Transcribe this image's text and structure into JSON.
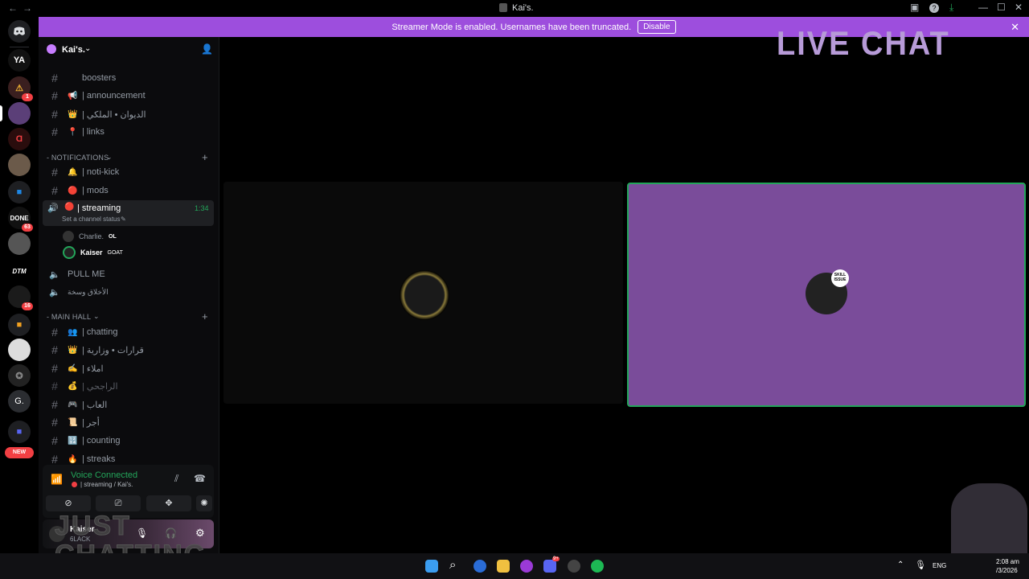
{
  "window": {
    "title": "Kai's.",
    "back_label": "←",
    "forward_label": "→",
    "minimize": "—",
    "maximize": "☐",
    "close": "✕"
  },
  "banner": {
    "text": "Streamer Mode is enabled. Usernames have been truncated.",
    "button_label": "Disable",
    "close_label": "✕"
  },
  "overlay": {
    "live_chat": "LIVE CHAT",
    "just_chatting_line1": "JUST",
    "just_chatting_line2": "CHATTING"
  },
  "rail": {
    "servers": [
      {
        "name": "discord-home",
        "label": "",
        "badge": ""
      },
      {
        "name": "YA",
        "label": "YA",
        "badge": ""
      },
      {
        "name": "server-a",
        "label": "",
        "badge": "1"
      },
      {
        "name": "server-b",
        "label": "",
        "badge": ""
      },
      {
        "name": "server-c",
        "label": "",
        "badge": ""
      },
      {
        "name": "server-d",
        "label": "",
        "badge": ""
      },
      {
        "name": "folder",
        "label": "",
        "badge": ""
      },
      {
        "name": "done",
        "label": "",
        "badge": "63"
      },
      {
        "name": "server-e",
        "label": "",
        "badge": ""
      },
      {
        "name": "dtm",
        "label": "DTM",
        "badge": ""
      },
      {
        "name": "server-f",
        "label": "",
        "badge": "16"
      },
      {
        "name": "folder-2",
        "label": "",
        "badge": ""
      },
      {
        "name": "server-g",
        "label": "",
        "badge": ""
      },
      {
        "name": "server-h",
        "label": "",
        "badge": ""
      },
      {
        "name": "G",
        "label": "G.",
        "badge": ""
      },
      {
        "name": "folder-3",
        "label": "",
        "badge": ""
      }
    ],
    "new_label": "NEW"
  },
  "sidebar": {
    "server_name": "Kai's.",
    "channels_top": [
      {
        "name": "boosters",
        "emoji": "",
        "label": "boosters"
      },
      {
        "name": "announcement",
        "emoji": "📢",
        "label": "| announcement"
      },
      {
        "name": "royal",
        "emoji": "👑",
        "label": "| الديوان • الملكي"
      },
      {
        "name": "links",
        "emoji": "📍",
        "label": "| links"
      }
    ],
    "cat_notifications": "- NOTIFICATIONS",
    "channels_notif": [
      {
        "name": "noti-kick",
        "emoji": "🔔",
        "label": "| noti-kick"
      },
      {
        "name": "mods",
        "emoji": "🔴",
        "label": "| mods"
      }
    ],
    "streaming": {
      "label": "| streaming",
      "timer": "1:34",
      "status": "Set a channel status"
    },
    "voice_users": [
      {
        "name": "Charlie.",
        "tag": "OL"
      },
      {
        "name": "Kaiser",
        "tag": "GOAT"
      }
    ],
    "voice_channels": [
      {
        "name": "pull-me",
        "label": "PULL ME"
      },
      {
        "name": "arabic-voice",
        "label": "الأخلاق وسخة"
      }
    ],
    "cat_main": "- MAIN HALL",
    "channels_main": [
      {
        "name": "chatting",
        "emoji": "👥",
        "label": "| chatting"
      },
      {
        "name": "decisions",
        "emoji": "👑",
        "label": "| قرارات • وزارية"
      },
      {
        "name": "dictation",
        "emoji": "✍",
        "label": "| املاء"
      },
      {
        "name": "rajhi",
        "emoji": "💰",
        "label": "| الراجحي"
      },
      {
        "name": "games",
        "emoji": "🎮",
        "label": "| العاب"
      },
      {
        "name": "reward",
        "emoji": "📜",
        "label": "| أجر"
      },
      {
        "name": "counting",
        "emoji": "🔢",
        "label": "| counting"
      },
      {
        "name": "streaks",
        "emoji": "🔥",
        "label": "| streaks"
      }
    ],
    "voice_connected": "Voice Connected",
    "voice_location": "| streaming / Kai's.",
    "user_name": "Kaiser",
    "user_status": "6LACK"
  },
  "main": {
    "tile_right_badge": "SKILL ISSUE"
  },
  "taskbar": {
    "lang": "ENG",
    "time": "2:08 am",
    "date": "/3/2026",
    "discord_badge": "9+"
  },
  "colors": {
    "banner": "#9d4edd",
    "tile_purple": "#7a4c9a",
    "speaking_green": "#23a55a"
  }
}
